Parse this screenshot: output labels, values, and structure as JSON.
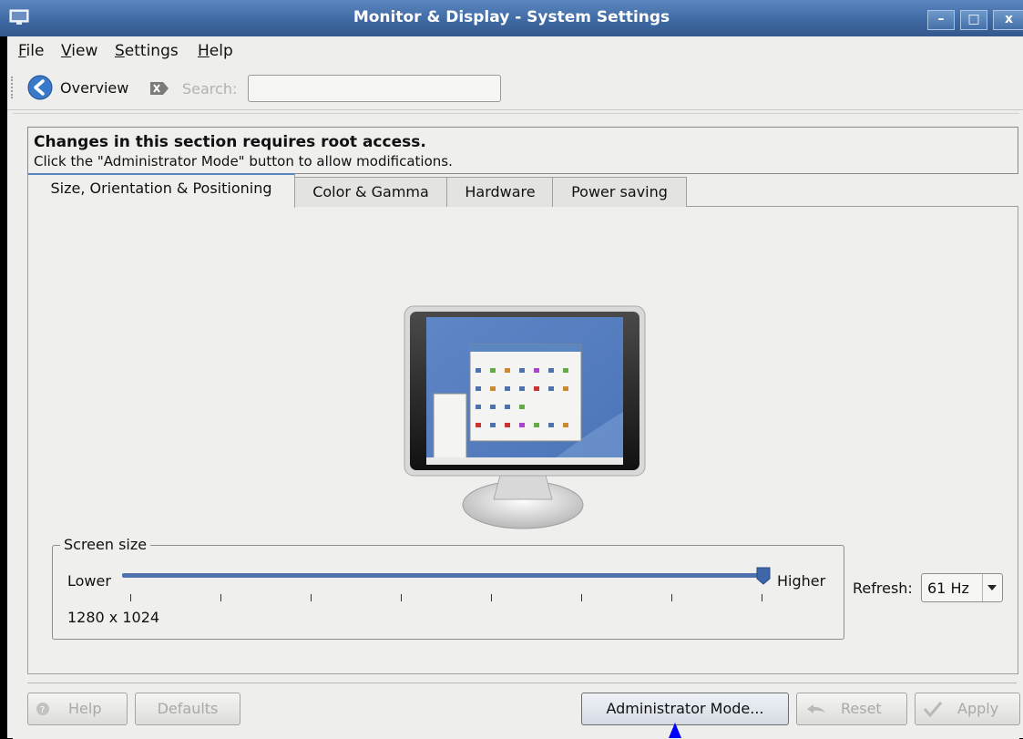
{
  "window": {
    "title": "Monitor & Display - System Settings",
    "controls": [
      "–",
      "□",
      "x"
    ]
  },
  "menubar": {
    "items": [
      {
        "label": "File",
        "accel": "F",
        "rest": "ile"
      },
      {
        "label": "View",
        "accel": "V",
        "rest": "iew"
      },
      {
        "label": "Settings",
        "accel": "S",
        "rest": "ettings"
      },
      {
        "label": "Help",
        "accel": "H",
        "rest": "elp"
      }
    ]
  },
  "toolbar": {
    "overview_label": "Overview",
    "search_label": "Search:",
    "search_value": "",
    "search_placeholder": ""
  },
  "notice": {
    "heading": "Changes in this section requires root access.",
    "body": "Click the \"Administrator Mode\" button to allow modifications."
  },
  "tabs": [
    {
      "label": "Size, Orientation & Positioning",
      "active": true
    },
    {
      "label": "Color & Gamma",
      "active": false
    },
    {
      "label": "Hardware",
      "active": false
    },
    {
      "label": "Power saving",
      "active": false
    }
  ],
  "screen_size": {
    "group_title": "Screen size",
    "lower_label": "Lower",
    "higher_label": "Higher",
    "resolution": "1280 x 1024",
    "slider_position": 1.0,
    "tick_count": 8
  },
  "refresh": {
    "label": "Refresh:",
    "value": "61 Hz"
  },
  "buttons": {
    "help": "Help",
    "defaults": "Defaults",
    "admin": "Administrator Mode...",
    "reset": "Reset",
    "apply": "Apply"
  },
  "colors": {
    "titlebar": "#3f6aa4",
    "accent": "#4d72ad",
    "window_bg": "#eeeeec",
    "cursor": "#0000ff"
  }
}
